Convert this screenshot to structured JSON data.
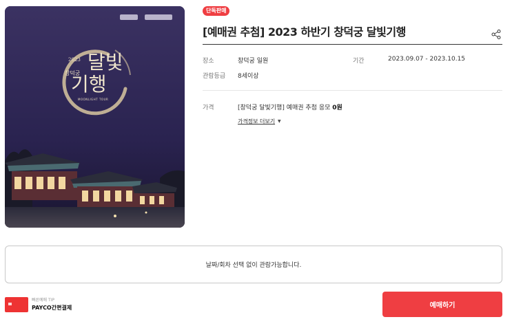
{
  "poster": {
    "year": "2023",
    "subtitle": "창덕궁",
    "title_line1": "달빛",
    "title_line2": "기행",
    "english_line": "MOONLIGHT TOUR"
  },
  "badge": "단독판매",
  "title": "[예매권 추첨] 2023 하반기 창덕궁 달빛기행",
  "share_icon": "share-icon",
  "info": {
    "place_label": "장소",
    "place_value": "창덕궁 일원",
    "period_label": "기간",
    "period_value": "2023.09.07 - 2023.10.15",
    "rating_label": "관람등급",
    "rating_value": "8세이상"
  },
  "price": {
    "label": "가격",
    "item_text": "[창덕궁 달빛기행] 예매권 추첨 응모",
    "amount": "0원",
    "more_link": "가격정보 더보기",
    "more_arrow": "▼"
  },
  "notice": "날짜/회차 선택 없이 관람가능합니다.",
  "tip": {
    "label": "빠른예매 TIP",
    "value": "PAYCO간편결제"
  },
  "book_button": "예매하기",
  "colors": {
    "accent": "#ef3e42",
    "poster_bg": "#2e2750"
  }
}
